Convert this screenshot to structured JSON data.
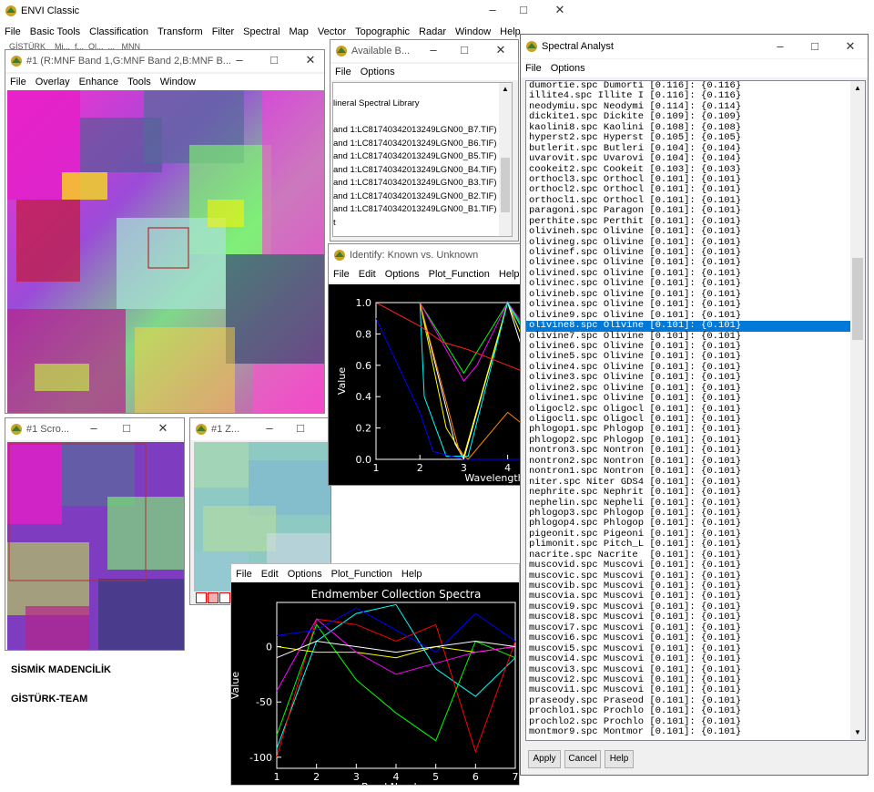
{
  "main": {
    "title": "ENVI Classic",
    "menu": [
      "File",
      "Basic Tools",
      "Classification",
      "Transform",
      "Filter",
      "Spectral",
      "Map",
      "Vector",
      "Topographic",
      "Radar",
      "Window",
      "Help"
    ],
    "submenu_partial": "GİSTÜRK    Mi...  f...  Ol...  ...   MNN"
  },
  "display1": {
    "title": "#1 (R:MNF Band 1,G:MNF Band 2,B:MNF B...",
    "menu": [
      "File",
      "Overlay",
      "Enhance",
      "Tools",
      "Window"
    ]
  },
  "scroll": {
    "title": "#1 Scro..."
  },
  "zoom": {
    "title": "#1 Z..."
  },
  "available": {
    "title": "Available B...",
    "menu": [
      "File",
      "Options"
    ],
    "items": [
      "lineral Spectral Library",
      "",
      "and 1:LC81740342013249LGN00_B7.TIF)",
      "and 1:LC81740342013249LGN00_B6.TIF)",
      "and 1:LC81740342013249LGN00_B5.TIF)",
      "and 1:LC81740342013249LGN00_B4.TIF)",
      "and 1:LC81740342013249LGN00_B3.TIF)",
      "and 1:LC81740342013249LGN00_B2.TIF)",
      "and 1:LC81740342013249LGN00_B1.TIF)",
      "t"
    ]
  },
  "identify": {
    "title": "Identify: Known vs. Unknown",
    "menu": [
      "File",
      "Edit",
      "Options",
      "Plot_Function",
      "Help"
    ],
    "ylabel": "Value",
    "xlabel": "Wavelength",
    "yticks": [
      "1.0",
      "0.8",
      "0.6",
      "0.4",
      "0.2",
      "0.0"
    ],
    "xticks": [
      "1",
      "2",
      "3",
      "4"
    ]
  },
  "endmember": {
    "menu": [
      "File",
      "Edit",
      "Options",
      "Plot_Function",
      "Help"
    ]
  },
  "spectral": {
    "title": "Spectral Analyst",
    "menu": [
      "File",
      "Options"
    ],
    "selected_index": 23,
    "rows": [
      "dumortie.spc Dumorti [0.116]: {0.116}",
      "illite4.spc Illite I [0.116]: {0.116}",
      "neodymiu.spc Neodymi [0.114]: {0.114}",
      "dickite1.spc Dickite [0.109]: {0.109}",
      "kaolini8.spc Kaolini [0.108]: {0.108}",
      "hyperst2.spc Hyperst [0.105]: {0.105}",
      "butlerit.spc Butleri [0.104]: {0.104}",
      "uvarovit.spc Uvarovi [0.104]: {0.104}",
      "cookeit2.spc Cookeit [0.103]: {0.103}",
      "orthocl3.spc Orthocl [0.101]: {0.101}",
      "orthocl2.spc Orthocl [0.101]: {0.101}",
      "orthocl1.spc Orthocl [0.101]: {0.101}",
      "paragoni.spc Paragon [0.101]: {0.101}",
      "perthite.spc Perthit [0.101]: {0.101}",
      "olivineh.spc Olivine [0.101]: {0.101}",
      "olivineg.spc Olivine [0.101]: {0.101}",
      "olivinef.spc Olivine [0.101]: {0.101}",
      "olivinee.spc Olivine [0.101]: {0.101}",
      "olivined.spc Olivine [0.101]: {0.101}",
      "olivinec.spc Olivine [0.101]: {0.101}",
      "olivineb.spc Olivine [0.101]: {0.101}",
      "olivinea.spc Olivine [0.101]: {0.101}",
      "olivine9.spc Olivine [0.101]: {0.101}",
      "olivine8.spc Olivine [0.101]: {0.101}",
      "olivine7.spc Olivine [0.101]: {0.101}",
      "olivine6.spc Olivine [0.101]: {0.101}",
      "olivine5.spc Olivine [0.101]: {0.101}",
      "olivine4.spc Olivine [0.101]: {0.101}",
      "olivine3.spc Olivine [0.101]: {0.101}",
      "olivine2.spc Olivine [0.101]: {0.101}",
      "olivine1.spc Olivine [0.101]: {0.101}",
      "oligocl2.spc Oligocl [0.101]: {0.101}",
      "oligocl1.spc Oligocl [0.101]: {0.101}",
      "phlogop1.spc Phlogop [0.101]: {0.101}",
      "phlogop2.spc Phlogop [0.101]: {0.101}",
      "nontron3.spc Nontron [0.101]: {0.101}",
      "nontron2.spc Nontron [0.101]: {0.101}",
      "nontron1.spc Nontron [0.101]: {0.101}",
      "niter.spc Niter GDS4 [0.101]: {0.101}",
      "nephrite.spc Nephrit [0.101]: {0.101}",
      "nephelin.spc Nepheli [0.101]: {0.101}",
      "phlogop3.spc Phlogop [0.101]: {0.101}",
      "phlogop4.spc Phlogop [0.101]: {0.101}",
      "pigeonit.spc Pigeoni [0.101]: {0.101}",
      "plimonit.spc Pitch_L [0.101]: {0.101}",
      "nacrite.spc Nacrite  [0.101]: {0.101}",
      "muscovid.spc Muscovi [0.101]: {0.101}",
      "muscovic.spc Muscovi [0.101]: {0.101}",
      "muscovib.spc Muscovi [0.101]: {0.101}",
      "muscovia.spc Muscovi [0.101]: {0.101}",
      "muscovi9.spc Muscovi [0.101]: {0.101}",
      "muscovi8.spc Muscovi [0.101]: {0.101}",
      "muscovi7.spc Muscovi [0.101]: {0.101}",
      "muscovi6.spc Muscovi [0.101]: {0.101}",
      "muscovi5.spc Muscovi [0.101]: {0.101}",
      "muscovi4.spc Muscovi [0.101]: {0.101}",
      "muscovi3.spc Muscovi [0.101]: {0.101}",
      "muscovi2.spc Muscovi [0.101]: {0.101}",
      "muscovi1.spc Muscovi [0.101]: {0.101}",
      "praseody.spc Praseod [0.101]: {0.101}",
      "prochlo1.spc Prochlo [0.101]: {0.101}",
      "prochlo2.spc Prochlo [0.101]: {0.101}",
      "montmor9.spc Montmor [0.101]: {0.101}"
    ],
    "buttons": {
      "apply": "Apply",
      "cancel": "Cancel",
      "help": "Help"
    }
  },
  "branding": {
    "line1": "SİSMİK MADENCİLİK",
    "line2": "GİSTÜRK-TEAM"
  },
  "chart_data": [
    {
      "type": "line",
      "title": "",
      "xlabel": "Wavelength",
      "ylabel": "Value",
      "xlim": [
        1,
        4.9
      ],
      "ylim": [
        0,
        1
      ],
      "series": [
        {
          "color": "#ffffff",
          "x": [
            2,
            2.8,
            3,
            3.5,
            4,
            4.9
          ],
          "y": [
            1,
            0.1,
            0,
            0.5,
            1,
            0.2
          ]
        },
        {
          "color": "#ffff00",
          "x": [
            2,
            2.6,
            3,
            4,
            4.9
          ],
          "y": [
            1,
            0.2,
            0.02,
            1,
            0.4
          ]
        },
        {
          "color": "#00ff00",
          "x": [
            2,
            3,
            4,
            4.9
          ],
          "y": [
            1,
            0.55,
            1,
            0.6
          ]
        },
        {
          "color": "#ff00ff",
          "x": [
            2,
            3,
            3.3,
            4,
            4.9
          ],
          "y": [
            1,
            0.5,
            0.6,
            1,
            0.65
          ]
        },
        {
          "color": "#00ffff",
          "x": [
            2,
            2.1,
            2.6,
            3.1,
            4,
            4.9
          ],
          "y": [
            1,
            0.4,
            0.02,
            0.02,
            1,
            0.55
          ]
        },
        {
          "color": "#ff2020",
          "x": [
            1,
            2,
            2.5,
            3.1,
            4,
            4.9
          ],
          "y": [
            1,
            0.85,
            0.75,
            0.7,
            0.6,
            0.5
          ]
        },
        {
          "color": "#0000ff",
          "x": [
            1,
            1.5,
            2,
            2.3,
            3,
            4.9
          ],
          "y": [
            0.9,
            0.6,
            0.3,
            0.05,
            0,
            0
          ]
        },
        {
          "color": "#ff8800",
          "x": [
            2,
            2.9,
            3.1,
            4,
            4.9
          ],
          "y": [
            1,
            0.05,
            0,
            0.3,
            0.1
          ]
        }
      ],
      "xticks": [
        1,
        2,
        3,
        4
      ],
      "yticks": [
        0,
        0.2,
        0.4,
        0.6,
        0.8,
        1
      ]
    },
    {
      "type": "line",
      "title": "Endmember Collection Spectra",
      "xlabel": "Band Number",
      "ylabel": "Value",
      "xlim": [
        1,
        7
      ],
      "ylim": [
        -110,
        40
      ],
      "series": [
        {
          "color": "#00ffff",
          "x": [
            1,
            2,
            3,
            4,
            5,
            6,
            7
          ],
          "y": [
            -92,
            5,
            30,
            38,
            -20,
            -45,
            -10
          ]
        },
        {
          "color": "#ff0000",
          "x": [
            1,
            2,
            3,
            4,
            5,
            6,
            7
          ],
          "y": [
            -100,
            25,
            20,
            5,
            20,
            -95,
            5
          ]
        },
        {
          "color": "#00ff00",
          "x": [
            1,
            2,
            3,
            4,
            5,
            6,
            7
          ],
          "y": [
            -80,
            20,
            -30,
            -60,
            -85,
            5,
            -10
          ]
        },
        {
          "color": "#ffff00",
          "x": [
            1,
            2,
            3,
            4,
            5,
            6,
            7
          ],
          "y": [
            0,
            -5,
            -5,
            -10,
            0,
            -5,
            0
          ]
        },
        {
          "color": "#ff00ff",
          "x": [
            1,
            2,
            3,
            4,
            5,
            6,
            7
          ],
          "y": [
            -40,
            25,
            -5,
            -25,
            -15,
            -5,
            0
          ]
        },
        {
          "color": "#0000ff",
          "x": [
            1,
            2,
            3,
            4,
            5,
            6,
            7
          ],
          "y": [
            10,
            15,
            35,
            15,
            -5,
            30,
            5
          ]
        },
        {
          "color": "#ffffff",
          "x": [
            1,
            2,
            3,
            4,
            5,
            6,
            7
          ],
          "y": [
            -10,
            5,
            0,
            -5,
            0,
            5,
            0
          ]
        }
      ],
      "xticks": [
        1,
        2,
        3,
        4,
        5,
        6,
        7
      ],
      "yticks": [
        0,
        -50,
        -100
      ]
    }
  ]
}
